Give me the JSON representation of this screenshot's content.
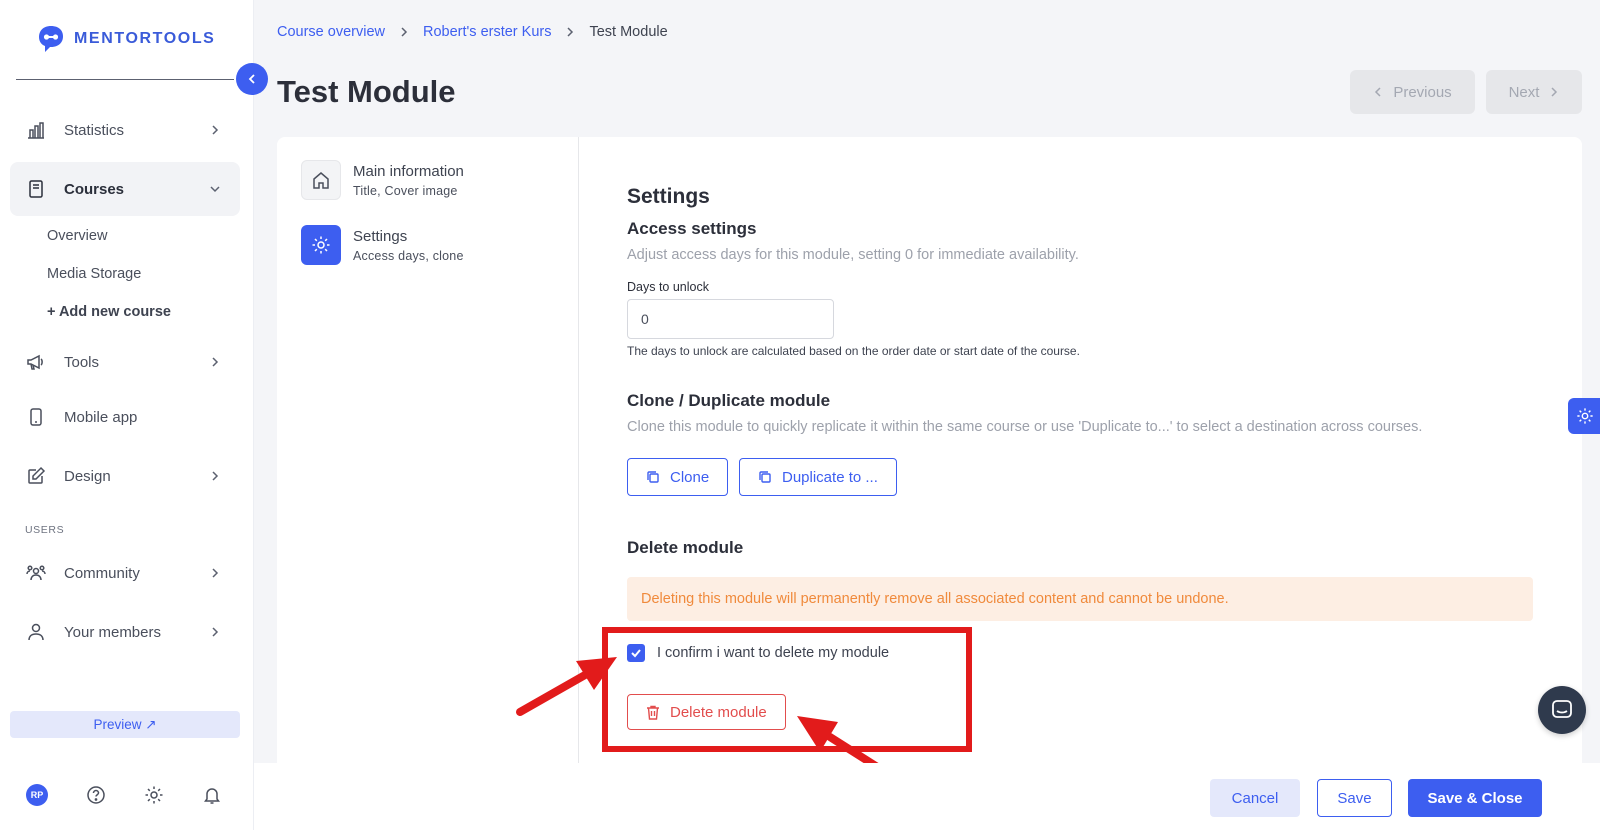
{
  "brand": {
    "name": "MENTORTOOLS",
    "accent": "#3d5ef0"
  },
  "sidebar": {
    "items": [
      {
        "label": "Statistics",
        "icon": "bar-chart-icon"
      },
      {
        "label": "Courses",
        "icon": "book-icon"
      },
      {
        "label": "Tools",
        "icon": "megaphone-icon"
      },
      {
        "label": "Mobile app",
        "icon": "phone-icon"
      },
      {
        "label": "Design",
        "icon": "pencil-icon"
      },
      {
        "label": "Community",
        "icon": "people-icon"
      },
      {
        "label": "Your members",
        "icon": "user-icon"
      }
    ],
    "courses_sub": [
      "Overview",
      "Media Storage",
      "+ Add new course"
    ],
    "users_section": "USERS",
    "preview_label": "Preview ↗",
    "avatar_initials": "RP"
  },
  "breadcrumb": {
    "items": [
      "Course overview",
      "Robert's erster Kurs"
    ],
    "current": "Test Module"
  },
  "page_title": "Test Module",
  "top_nav": {
    "previous": "Previous",
    "next": "Next"
  },
  "tabs": [
    {
      "title": "Main information",
      "subtitle": "Title, Cover image",
      "icon": "home-icon"
    },
    {
      "title": "Settings",
      "subtitle": "Access days, clone",
      "icon": "gear-icon"
    }
  ],
  "settings": {
    "heading": "Settings",
    "access": {
      "title": "Access settings",
      "description": "Adjust access days for this module, setting 0 for immediate availability.",
      "field_label": "Days to unlock",
      "field_value": "0",
      "hint": "The days to unlock are calculated based on the order date or start date of the course."
    },
    "clone": {
      "title": "Clone / Duplicate module",
      "description": "Clone this module to quickly replicate it within the same course or use 'Duplicate to...' to select a destination across courses.",
      "clone_label": "Clone",
      "duplicate_label": "Duplicate to ..."
    },
    "delete": {
      "title": "Delete module",
      "warning": "Deleting this module will permanently remove all associated content and cannot be undone.",
      "confirm_label": "I confirm i want to delete my module",
      "confirm_checked": true,
      "button_label": "Delete module"
    }
  },
  "footer": {
    "cancel": "Cancel",
    "save": "Save",
    "save_close": "Save & Close"
  }
}
